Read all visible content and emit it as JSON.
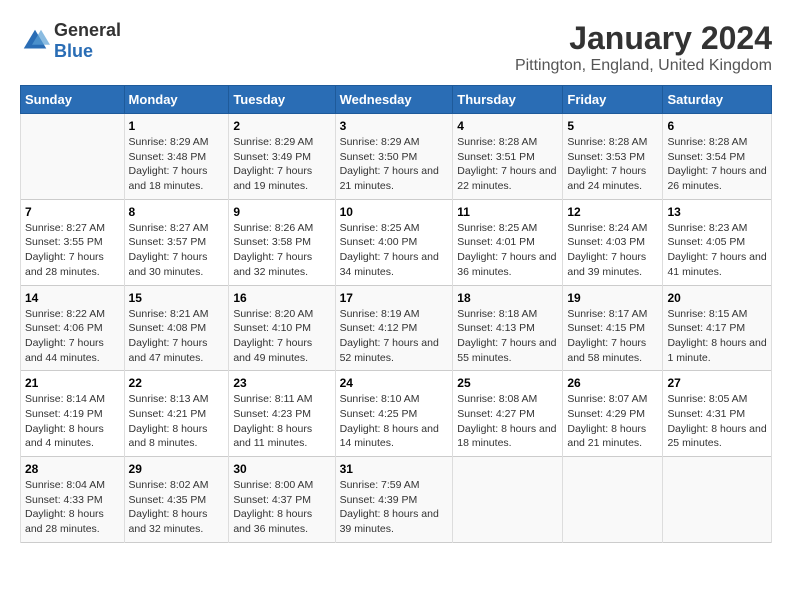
{
  "logo": {
    "general": "General",
    "blue": "Blue"
  },
  "title": "January 2024",
  "subtitle": "Pittington, England, United Kingdom",
  "days_of_week": [
    "Sunday",
    "Monday",
    "Tuesday",
    "Wednesday",
    "Thursday",
    "Friday",
    "Saturday"
  ],
  "weeks": [
    [
      {
        "day": "",
        "sunrise": "",
        "sunset": "",
        "daylight": ""
      },
      {
        "day": "1",
        "sunrise": "Sunrise: 8:29 AM",
        "sunset": "Sunset: 3:48 PM",
        "daylight": "Daylight: 7 hours and 18 minutes."
      },
      {
        "day": "2",
        "sunrise": "Sunrise: 8:29 AM",
        "sunset": "Sunset: 3:49 PM",
        "daylight": "Daylight: 7 hours and 19 minutes."
      },
      {
        "day": "3",
        "sunrise": "Sunrise: 8:29 AM",
        "sunset": "Sunset: 3:50 PM",
        "daylight": "Daylight: 7 hours and 21 minutes."
      },
      {
        "day": "4",
        "sunrise": "Sunrise: 8:28 AM",
        "sunset": "Sunset: 3:51 PM",
        "daylight": "Daylight: 7 hours and 22 minutes."
      },
      {
        "day": "5",
        "sunrise": "Sunrise: 8:28 AM",
        "sunset": "Sunset: 3:53 PM",
        "daylight": "Daylight: 7 hours and 24 minutes."
      },
      {
        "day": "6",
        "sunrise": "Sunrise: 8:28 AM",
        "sunset": "Sunset: 3:54 PM",
        "daylight": "Daylight: 7 hours and 26 minutes."
      }
    ],
    [
      {
        "day": "7",
        "sunrise": "Sunrise: 8:27 AM",
        "sunset": "Sunset: 3:55 PM",
        "daylight": "Daylight: 7 hours and 28 minutes."
      },
      {
        "day": "8",
        "sunrise": "Sunrise: 8:27 AM",
        "sunset": "Sunset: 3:57 PM",
        "daylight": "Daylight: 7 hours and 30 minutes."
      },
      {
        "day": "9",
        "sunrise": "Sunrise: 8:26 AM",
        "sunset": "Sunset: 3:58 PM",
        "daylight": "Daylight: 7 hours and 32 minutes."
      },
      {
        "day": "10",
        "sunrise": "Sunrise: 8:25 AM",
        "sunset": "Sunset: 4:00 PM",
        "daylight": "Daylight: 7 hours and 34 minutes."
      },
      {
        "day": "11",
        "sunrise": "Sunrise: 8:25 AM",
        "sunset": "Sunset: 4:01 PM",
        "daylight": "Daylight: 7 hours and 36 minutes."
      },
      {
        "day": "12",
        "sunrise": "Sunrise: 8:24 AM",
        "sunset": "Sunset: 4:03 PM",
        "daylight": "Daylight: 7 hours and 39 minutes."
      },
      {
        "day": "13",
        "sunrise": "Sunrise: 8:23 AM",
        "sunset": "Sunset: 4:05 PM",
        "daylight": "Daylight: 7 hours and 41 minutes."
      }
    ],
    [
      {
        "day": "14",
        "sunrise": "Sunrise: 8:22 AM",
        "sunset": "Sunset: 4:06 PM",
        "daylight": "Daylight: 7 hours and 44 minutes."
      },
      {
        "day": "15",
        "sunrise": "Sunrise: 8:21 AM",
        "sunset": "Sunset: 4:08 PM",
        "daylight": "Daylight: 7 hours and 47 minutes."
      },
      {
        "day": "16",
        "sunrise": "Sunrise: 8:20 AM",
        "sunset": "Sunset: 4:10 PM",
        "daylight": "Daylight: 7 hours and 49 minutes."
      },
      {
        "day": "17",
        "sunrise": "Sunrise: 8:19 AM",
        "sunset": "Sunset: 4:12 PM",
        "daylight": "Daylight: 7 hours and 52 minutes."
      },
      {
        "day": "18",
        "sunrise": "Sunrise: 8:18 AM",
        "sunset": "Sunset: 4:13 PM",
        "daylight": "Daylight: 7 hours and 55 minutes."
      },
      {
        "day": "19",
        "sunrise": "Sunrise: 8:17 AM",
        "sunset": "Sunset: 4:15 PM",
        "daylight": "Daylight: 7 hours and 58 minutes."
      },
      {
        "day": "20",
        "sunrise": "Sunrise: 8:15 AM",
        "sunset": "Sunset: 4:17 PM",
        "daylight": "Daylight: 8 hours and 1 minute."
      }
    ],
    [
      {
        "day": "21",
        "sunrise": "Sunrise: 8:14 AM",
        "sunset": "Sunset: 4:19 PM",
        "daylight": "Daylight: 8 hours and 4 minutes."
      },
      {
        "day": "22",
        "sunrise": "Sunrise: 8:13 AM",
        "sunset": "Sunset: 4:21 PM",
        "daylight": "Daylight: 8 hours and 8 minutes."
      },
      {
        "day": "23",
        "sunrise": "Sunrise: 8:11 AM",
        "sunset": "Sunset: 4:23 PM",
        "daylight": "Daylight: 8 hours and 11 minutes."
      },
      {
        "day": "24",
        "sunrise": "Sunrise: 8:10 AM",
        "sunset": "Sunset: 4:25 PM",
        "daylight": "Daylight: 8 hours and 14 minutes."
      },
      {
        "day": "25",
        "sunrise": "Sunrise: 8:08 AM",
        "sunset": "Sunset: 4:27 PM",
        "daylight": "Daylight: 8 hours and 18 minutes."
      },
      {
        "day": "26",
        "sunrise": "Sunrise: 8:07 AM",
        "sunset": "Sunset: 4:29 PM",
        "daylight": "Daylight: 8 hours and 21 minutes."
      },
      {
        "day": "27",
        "sunrise": "Sunrise: 8:05 AM",
        "sunset": "Sunset: 4:31 PM",
        "daylight": "Daylight: 8 hours and 25 minutes."
      }
    ],
    [
      {
        "day": "28",
        "sunrise": "Sunrise: 8:04 AM",
        "sunset": "Sunset: 4:33 PM",
        "daylight": "Daylight: 8 hours and 28 minutes."
      },
      {
        "day": "29",
        "sunrise": "Sunrise: 8:02 AM",
        "sunset": "Sunset: 4:35 PM",
        "daylight": "Daylight: 8 hours and 32 minutes."
      },
      {
        "day": "30",
        "sunrise": "Sunrise: 8:00 AM",
        "sunset": "Sunset: 4:37 PM",
        "daylight": "Daylight: 8 hours and 36 minutes."
      },
      {
        "day": "31",
        "sunrise": "Sunrise: 7:59 AM",
        "sunset": "Sunset: 4:39 PM",
        "daylight": "Daylight: 8 hours and 39 minutes."
      },
      {
        "day": "",
        "sunrise": "",
        "sunset": "",
        "daylight": ""
      },
      {
        "day": "",
        "sunrise": "",
        "sunset": "",
        "daylight": ""
      },
      {
        "day": "",
        "sunrise": "",
        "sunset": "",
        "daylight": ""
      }
    ]
  ]
}
